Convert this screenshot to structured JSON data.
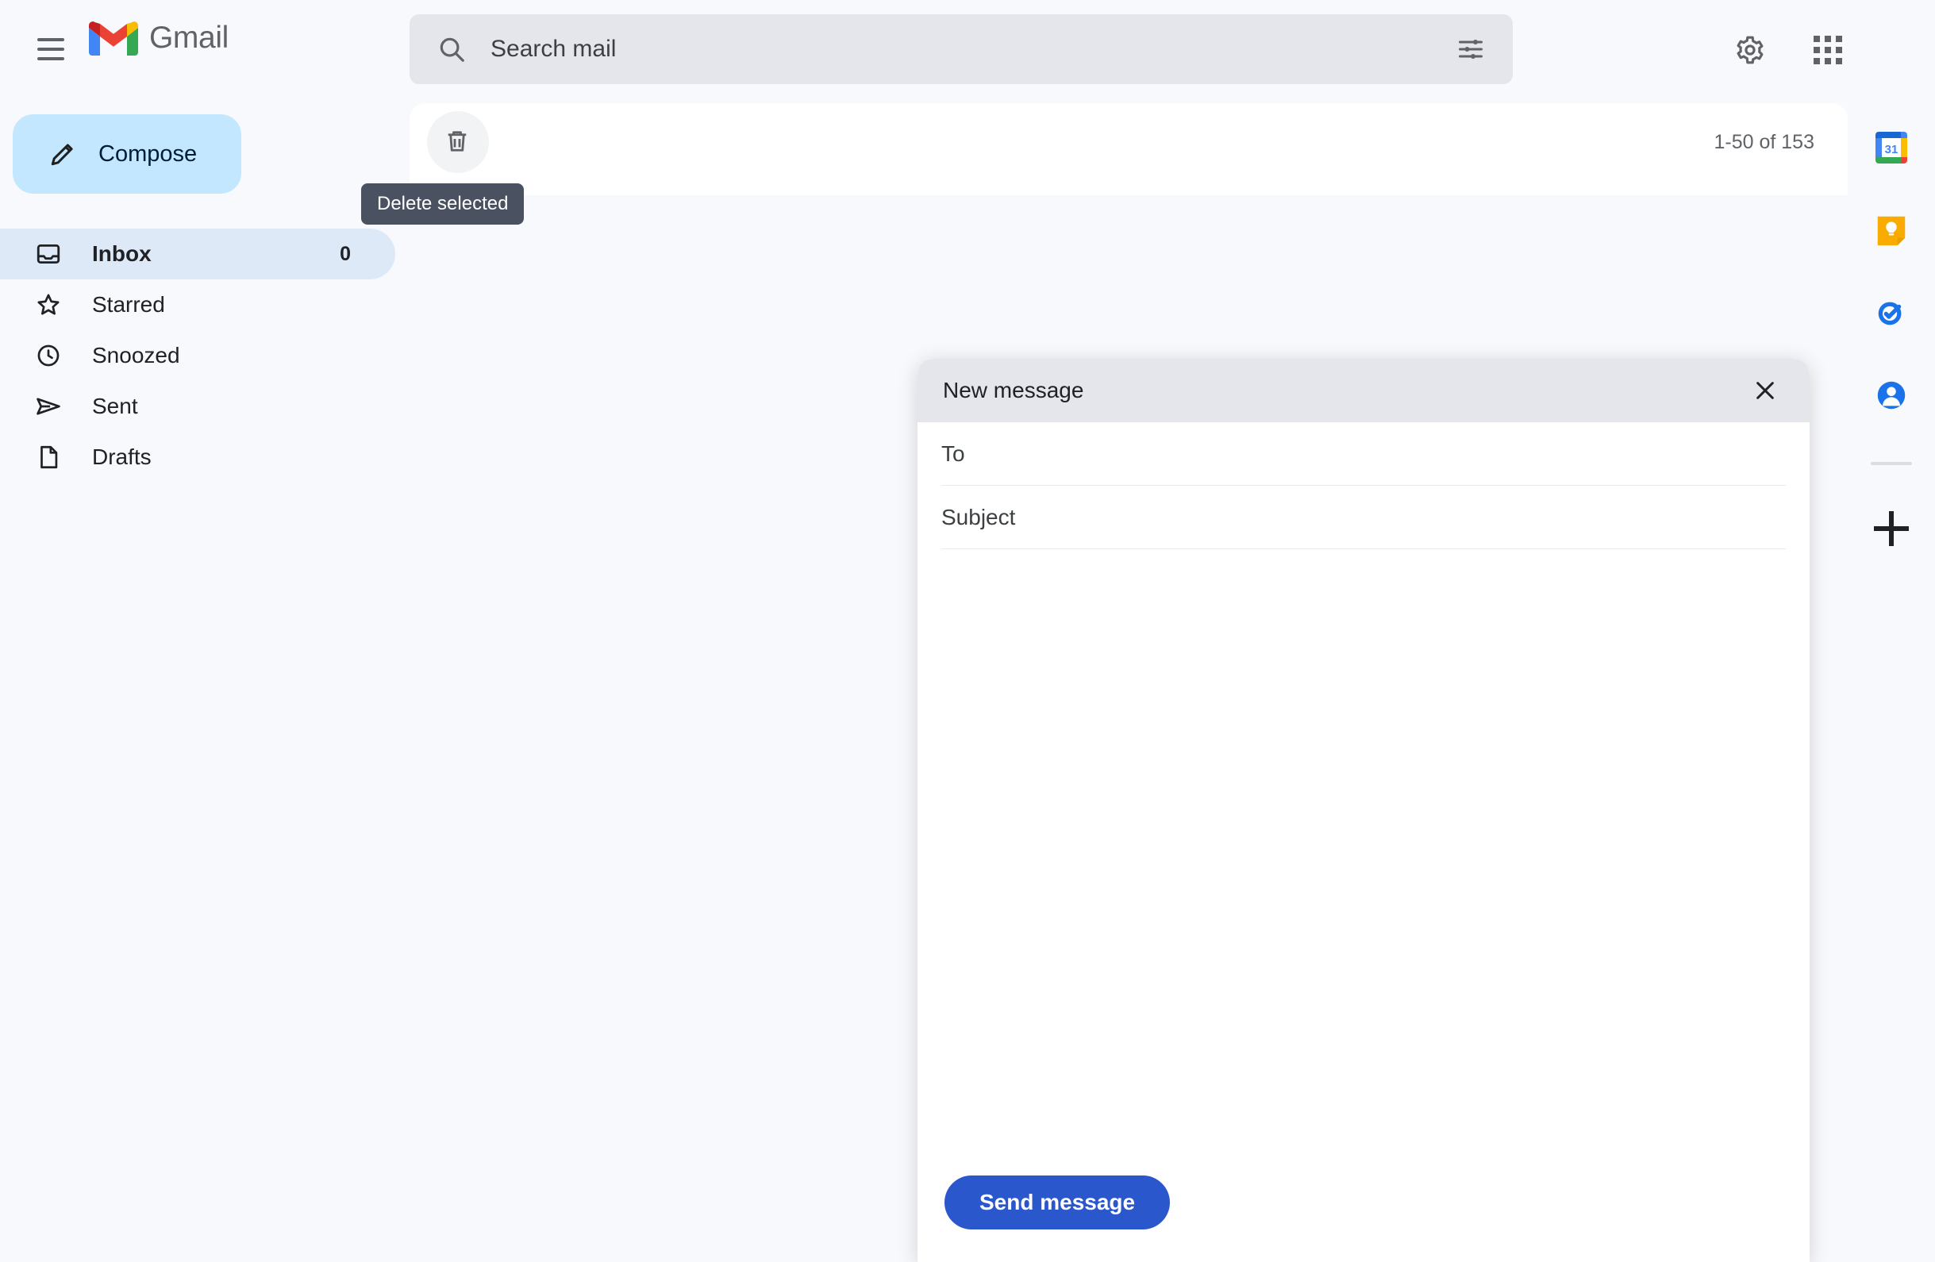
{
  "app": {
    "name": "Gmail",
    "background_color": "#F8F9FC"
  },
  "header": {
    "menu_icon": "hamburger-menu-icon",
    "logo_icon": "gmail-logo-icon",
    "brand_label": "Gmail",
    "search": {
      "icon": "search-icon",
      "placeholder": "Search mail",
      "value": "",
      "filter_icon": "tune-filter-icon",
      "background_color": "#E4E6EB"
    },
    "settings_icon": "gear-icon",
    "apps_icon": "apps-grid-icon"
  },
  "sidebar": {
    "compose": {
      "label": "Compose",
      "icon": "pencil-icon",
      "background_color": "#C2E7FF"
    },
    "items": [
      {
        "label": "Inbox",
        "icon": "inbox-icon",
        "count": "0",
        "active": true
      },
      {
        "label": "Starred",
        "icon": "star-icon",
        "count": "",
        "active": false
      },
      {
        "label": "Snoozed",
        "icon": "clock-icon",
        "count": "",
        "active": false
      },
      {
        "label": "Sent",
        "icon": "send-icon",
        "count": "",
        "active": false
      },
      {
        "label": "Drafts",
        "icon": "drafts-icon",
        "count": "",
        "active": false
      }
    ],
    "active_background_color": "#DEE9F8"
  },
  "toolbar": {
    "delete_icon": "trash-icon",
    "pagination": "1-50 of 153"
  },
  "tooltip": {
    "text": "Delete selected",
    "background_color": "#4A5160"
  },
  "side_panel": {
    "items": [
      {
        "icon": "google-calendar-icon",
        "label": "31"
      },
      {
        "icon": "google-keep-icon",
        "label": ""
      },
      {
        "icon": "google-tasks-icon",
        "label": ""
      },
      {
        "icon": "google-contacts-icon",
        "label": ""
      }
    ],
    "add_icon": "plus-icon"
  },
  "compose_dialog": {
    "title": "New message",
    "close_icon": "close-icon",
    "header_background_color": "#E4E6EB",
    "to_placeholder": "To",
    "to_value": "",
    "subject_placeholder": "Subject",
    "subject_value": "",
    "body_placeholder": "",
    "body_value": "",
    "send_label": "Send message",
    "send_color": "#2B57CC"
  }
}
